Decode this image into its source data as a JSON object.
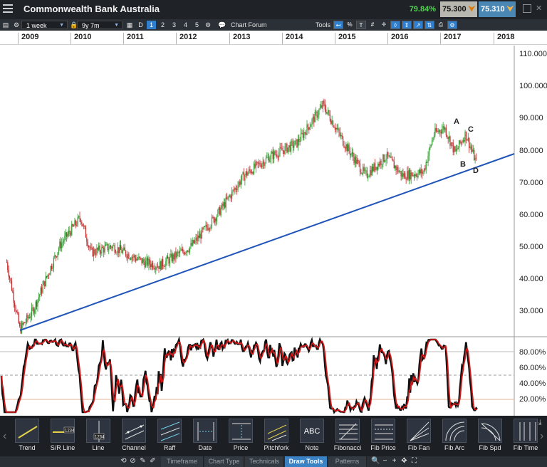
{
  "header": {
    "instrument_name": "Commonwealth Bank Australia",
    "change_pct": "79.84%",
    "bid": "75.300",
    "ask": "75.310",
    "colors": {
      "up": "#4fd34f",
      "bid_bg": "#b8b8b0",
      "ask_bg": "#4b87b5"
    }
  },
  "toolbar": {
    "interval": "1 week",
    "range": "9y 7m",
    "day_button": "D",
    "chart_counts": [
      "1",
      "2",
      "3",
      "4",
      "5"
    ],
    "selected_count": "1",
    "chart_forum": "Chart Forum",
    "tools_label": "Tools",
    "percent_label": "%"
  },
  "year_axis": [
    "2009",
    "2010",
    "2011",
    "2012",
    "2013",
    "2014",
    "2015",
    "2016",
    "2017",
    "2018"
  ],
  "chart": {
    "price_axis": [
      "110.000",
      "100.000",
      "90.000",
      "80.000",
      "70.000",
      "60.000",
      "50.000",
      "40.000",
      "30.000"
    ],
    "price_range": [
      20,
      113
    ],
    "osc_axis": [
      "80.00%",
      "60.00%",
      "40.00%",
      "20.00%"
    ],
    "annotations": {
      "A": "A",
      "B": "B",
      "C": "C",
      "D": "D"
    },
    "colors": {
      "up_candle": "#2e9a2e",
      "down_candle": "#c0282a",
      "trendline": "#1f54b8",
      "osc_k": "#111111",
      "osc_d": "#d01818"
    }
  },
  "chart_data": {
    "type": "candlestick",
    "instrument": "Commonwealth Bank Australia",
    "interval": "1 week",
    "x_range": [
      "2009",
      "2018"
    ],
    "ylim": [
      20,
      113
    ],
    "price_path": [
      [
        "2009",
        45
      ],
      [
        "2009.25",
        24
      ],
      [
        "2009.5",
        30
      ],
      [
        "2010",
        50
      ],
      [
        "2010.4",
        59
      ],
      [
        "2010.6",
        48
      ],
      [
        "2011",
        50
      ],
      [
        "2011.6",
        45
      ],
      [
        "2011.9",
        44
      ],
      [
        "2012.5",
        50
      ],
      [
        "2013",
        60
      ],
      [
        "2013.5",
        72
      ],
      [
        "2014",
        78
      ],
      [
        "2014.5",
        82
      ],
      [
        "2015",
        94
      ],
      [
        "2015.4",
        82
      ],
      [
        "2015.8",
        72
      ],
      [
        "2016.2",
        78
      ],
      [
        "2016.5",
        72
      ],
      [
        "2016.9",
        73
      ],
      [
        "2017.1",
        85
      ],
      [
        "2017.3",
        87
      ],
      [
        "2017.5",
        79
      ],
      [
        "2017.7",
        85
      ],
      [
        "2017.9",
        76
      ]
    ],
    "trendline": {
      "from": [
        "2009.2",
        23
      ],
      "to": [
        "2018",
        79
      ]
    },
    "annotations": [
      {
        "label": "A",
        "x": "2017.3",
        "y": 87
      },
      {
        "label": "B",
        "x": "2017.45",
        "y": 79
      },
      {
        "label": "C",
        "x": "2017.7",
        "y": 85
      },
      {
        "label": "D",
        "x": "2017.9",
        "y": 76
      }
    ],
    "oscillator": {
      "ylim": [
        0,
        100
      ],
      "levels": [
        80,
        50,
        20
      ]
    }
  },
  "draw_tools": [
    "Trend",
    "S/R Line",
    "Line",
    "Channel",
    "Raff",
    "Date",
    "Price",
    "Pitchfork",
    "Note",
    "Fibonacci",
    "Fib Price",
    "Fib Fan",
    "Fib Arc",
    "Fib Spd",
    "Fib Time"
  ],
  "tool_badges": {
    "sr_line": "1234",
    "line": "1234",
    "note": "ABC"
  },
  "bottom_tabs": [
    "Timeframe",
    "Chart Type",
    "Technicals",
    "Draw Tools",
    "Patterns"
  ],
  "active_tab": "Draw Tools"
}
